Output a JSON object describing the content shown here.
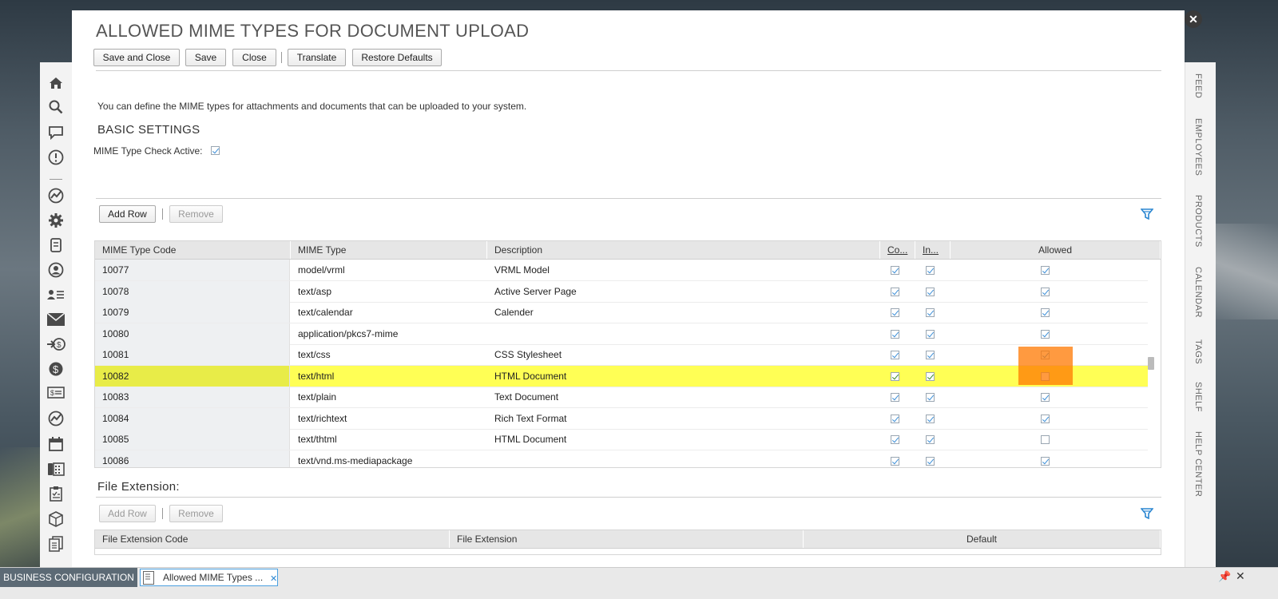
{
  "window": {
    "title": "ALLOWED MIME TYPES FOR DOCUMENT UPLOAD"
  },
  "toolbar": {
    "save_and_close": "Save and Close",
    "save": "Save",
    "close": "Close",
    "translate": "Translate",
    "restore_defaults": "Restore Defaults"
  },
  "info_text": "You can define the MIME types for attachments and documents that can be uploaded to your system.",
  "basic_settings": {
    "title": "BASIC SETTINGS",
    "mime_check_label": "MIME Type Check Active:",
    "mime_check_value": true
  },
  "mime_table": {
    "add_row": "Add Row",
    "remove": "Remove",
    "columns": [
      "MIME Type Code",
      "MIME Type",
      "Description",
      "Co...",
      "In...",
      "Allowed"
    ],
    "rows": [
      {
        "code": "10077",
        "type": "model/vrml",
        "description": "VRML Model",
        "co": true,
        "in": true,
        "allowed": true
      },
      {
        "code": "10078",
        "type": "text/asp",
        "description": "Active Server Page",
        "co": true,
        "in": true,
        "allowed": true
      },
      {
        "code": "10079",
        "type": "text/calendar",
        "description": "Calender",
        "co": true,
        "in": true,
        "allowed": true
      },
      {
        "code": "10080",
        "type": "application/pkcs7-mime",
        "description": "",
        "co": true,
        "in": true,
        "allowed": true
      },
      {
        "code": "10081",
        "type": "text/css",
        "description": "CSS Stylesheet",
        "co": true,
        "in": true,
        "allowed": true
      },
      {
        "code": "10082",
        "type": "text/html",
        "description": "HTML Document",
        "co": true,
        "in": true,
        "allowed": false,
        "selected": true
      },
      {
        "code": "10083",
        "type": "text/plain",
        "description": "Text Document",
        "co": true,
        "in": true,
        "allowed": true
      },
      {
        "code": "10084",
        "type": "text/richtext",
        "description": "Rich Text Format",
        "co": true,
        "in": true,
        "allowed": true
      },
      {
        "code": "10085",
        "type": "text/thtml",
        "description": "HTML Document",
        "co": true,
        "in": true,
        "allowed": false
      },
      {
        "code": "10086",
        "type": "text/vnd.ms-mediapackage",
        "description": "",
        "co": true,
        "in": true,
        "allowed": true
      }
    ]
  },
  "file_extension": {
    "title": "File Extension:",
    "add_row": "Add Row",
    "remove": "Remove",
    "columns": [
      "File Extension Code",
      "File Extension",
      "Default"
    ]
  },
  "right_tabs": [
    "FEED",
    "EMPLOYEES",
    "PRODUCTS",
    "CALENDAR",
    "TAGS",
    "SHELF",
    "HELP CENTER"
  ],
  "left_icons": [
    "home-icon",
    "search-icon",
    "chat-icon",
    "alert-icon",
    "analytics-icon",
    "settings-icon",
    "document-icon",
    "person-icon",
    "contacts-icon",
    "mail-icon",
    "payment-icon",
    "dollar-icon",
    "invoice-icon",
    "reports-icon",
    "calendar-icon",
    "phone-icon",
    "tasks-icon",
    "package-icon",
    "pages-icon"
  ],
  "taskbar": {
    "section": "BUSINESS CONFIGURATION",
    "tab": "Allowed MIME Types ..."
  },
  "colors": {
    "highlight": "#ffff55",
    "accent": "#2a86d1",
    "mark": "#ff7800"
  }
}
